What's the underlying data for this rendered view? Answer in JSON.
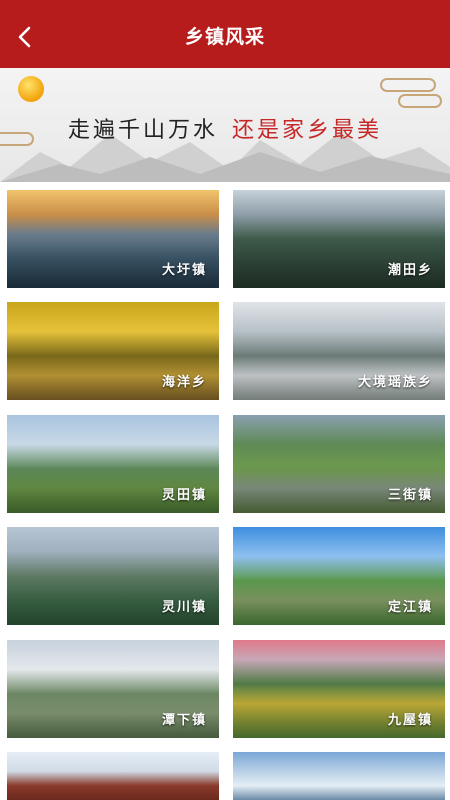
{
  "header": {
    "title": "乡镇风采",
    "back_icon": "back-arrow-icon"
  },
  "banner": {
    "slogan_part1": "走遍千山万水",
    "slogan_part2": "还是家乡最美"
  },
  "colors": {
    "header": "#b71c1c",
    "slogan_highlight": "#c62828"
  },
  "towns": [
    {
      "name": "大圩镇"
    },
    {
      "name": "潮田乡"
    },
    {
      "name": "海洋乡"
    },
    {
      "name": "大境瑶族乡"
    },
    {
      "name": "灵田镇"
    },
    {
      "name": "三街镇"
    },
    {
      "name": "灵川镇"
    },
    {
      "name": "定江镇"
    },
    {
      "name": "潭下镇"
    },
    {
      "name": "九屋镇"
    },
    {
      "name": ""
    },
    {
      "name": ""
    }
  ]
}
